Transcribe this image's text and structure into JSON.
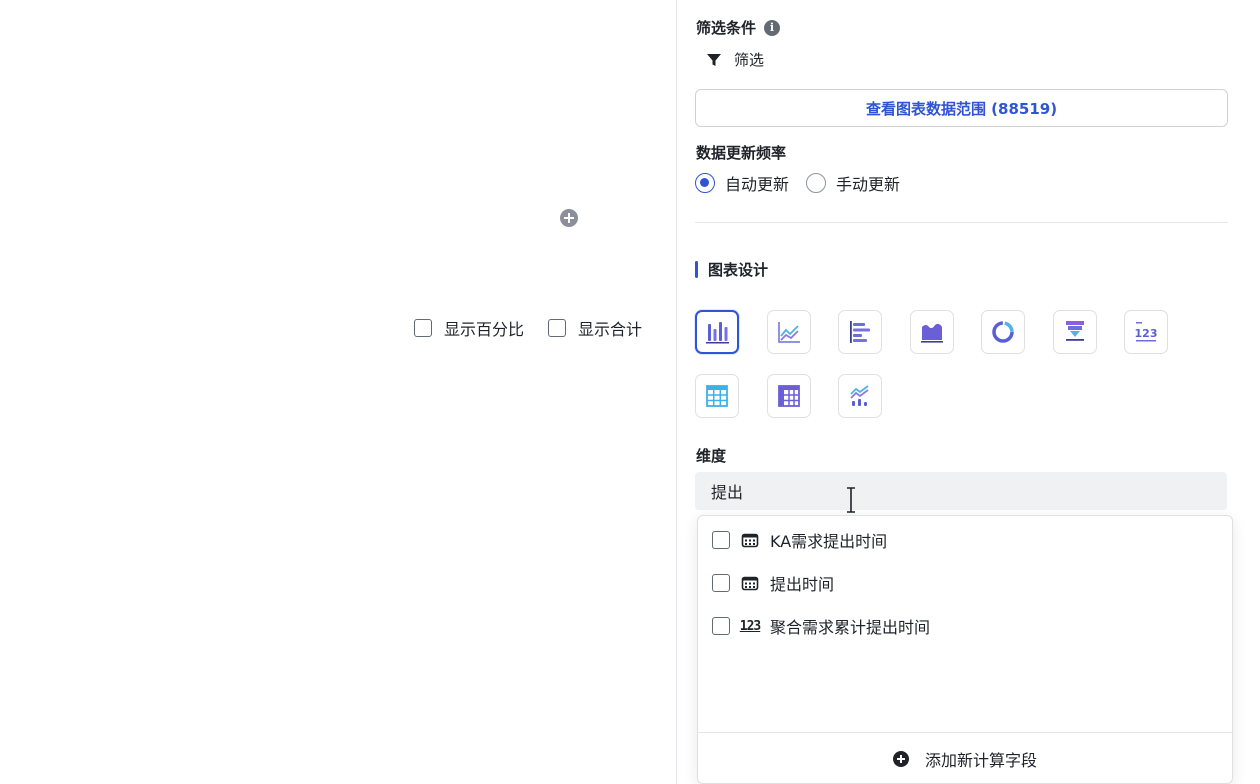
{
  "canvas": {
    "show_percent_label": "显示百分比",
    "show_total_label": "显示合计"
  },
  "filter": {
    "title": "筛选条件",
    "filter_label": "筛选",
    "range_button": "查看图表数据范围 (88519)"
  },
  "update": {
    "title": "数据更新频率",
    "options": [
      {
        "label": "自动更新",
        "selected": true
      },
      {
        "label": "手动更新",
        "selected": false
      }
    ]
  },
  "design": {
    "title": "图表设计",
    "chart_types": [
      "bar-chart-icon",
      "line-chart-icon",
      "horizontal-bar-icon",
      "area-chart-icon",
      "donut-chart-icon",
      "funnel-chart-icon",
      "number-card-icon",
      "table-icon",
      "pivot-table-icon",
      "combo-chart-icon"
    ]
  },
  "dimension": {
    "title": "维度",
    "search_value": "提出",
    "options": [
      {
        "label": "KA需求提出时间",
        "icon": "calendar-icon"
      },
      {
        "label": "提出时间",
        "icon": "calendar-icon"
      },
      {
        "label": "聚合需求累计提出时间",
        "icon": "number-icon"
      }
    ],
    "number_icon_text": "123",
    "add_field": "添加新计算字段"
  },
  "colors": {
    "accent": "#2f55d4"
  }
}
